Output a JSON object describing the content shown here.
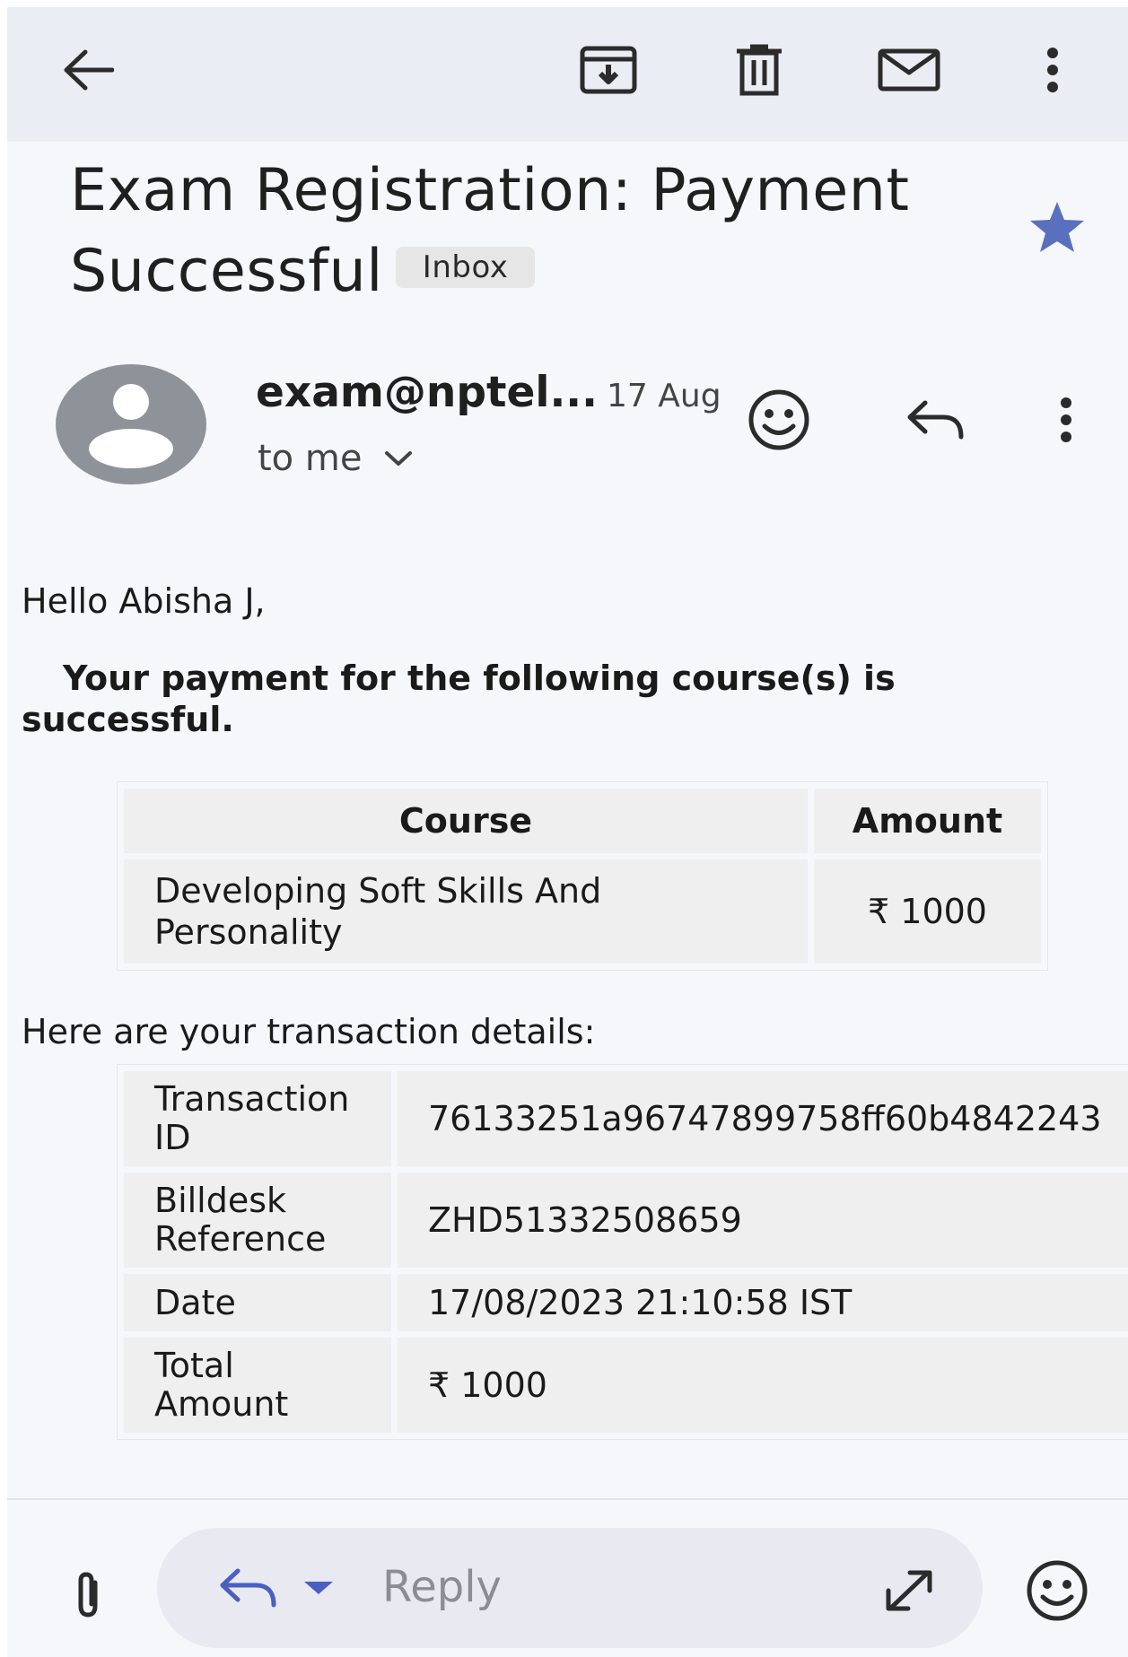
{
  "subject": {
    "title": "Exam Registration: Payment Successful",
    "label_badge": "Inbox"
  },
  "sender": {
    "name": "exam@nptel...",
    "date": "17 Aug",
    "recipient": "to me"
  },
  "body": {
    "greeting": "Hello Abisha J,",
    "payment_message": "Your payment for the following course(s) is successful.",
    "course_table": {
      "headers": [
        "Course",
        "Amount"
      ],
      "rows": [
        {
          "course": "Developing Soft Skills And Personality",
          "amount": "₹ 1000"
        }
      ]
    },
    "transaction_intro": "Here are your transaction details:",
    "transaction_table": [
      {
        "label": "Transaction ID",
        "value": "76133251a96747899758ff60b4842243"
      },
      {
        "label": "Billdesk Reference",
        "value": "ZHD51332508659"
      },
      {
        "label": "Date",
        "value": "17/08/2023 21:10:58 IST"
      },
      {
        "label": "Total Amount",
        "value": "₹ 1000"
      }
    ]
  },
  "compose": {
    "placeholder": "Reply"
  },
  "icons": {
    "toolbar": [
      "back-arrow-icon",
      "archive-icon",
      "delete-icon",
      "mark-unread-icon",
      "more-vert-icon"
    ],
    "star": "star-icon",
    "sender_actions": [
      "emoji-reaction-icon",
      "reply-icon",
      "more-vert-icon"
    ],
    "bottom": [
      "attachment-icon",
      "reply-icon",
      "dropdown-icon",
      "expand-icon",
      "emoji-icon"
    ]
  },
  "colors": {
    "star": "#5b6fbf",
    "appbar_bg": "#ebedf4",
    "page_bg": "#f6f7fb",
    "avatar_bg": "#8e9399",
    "table_cell_bg": "#efefef",
    "reply_pill_bg": "#e8e9f1"
  }
}
